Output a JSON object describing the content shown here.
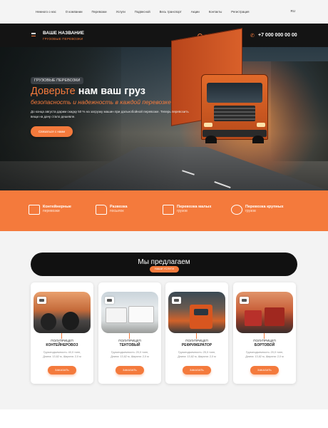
{
  "topnav": {
    "items": [
      "Немного о нас",
      "О компании",
      "Перевозки",
      "Услуги",
      "Подвесной",
      "Весь транспорт",
      "Акции",
      "Контакты",
      "Регистрация"
    ],
    "lang": "RU"
  },
  "header": {
    "title": "ВАШЕ НАЗВАНИЕ",
    "subtitle": "ГРУЗОВЫЕ ПЕРЕВОЗКИ",
    "hours": "Ежедневно: 09:00—21:00",
    "phone": "+7 000 000 00 00"
  },
  "hero": {
    "badge": "ГРУЗОВЫЕ ПЕРЕВОЗКИ",
    "title_prefix": "Доверьте",
    "title_bold": "нам ваш груз",
    "subtitle": "безопасность и надежность в каждой перевозке",
    "description": "До конца августа дарим скидку 50 % на загрузку машин при дальнобойной перевозке. Теперь перевозить вещи на дачу стало дешевле.",
    "button": "Связаться с нами"
  },
  "services": [
    {
      "title": "Контейнерные",
      "sub": "перевозки",
      "icon": "container-icon"
    },
    {
      "title": "Развозка",
      "sub": "посылок",
      "icon": "delivery-truck-icon"
    },
    {
      "title": "Перевозка малых",
      "sub": "грузов",
      "icon": "boxes-icon"
    },
    {
      "title": "Перевозка крупных",
      "sub": "грузов",
      "icon": "globe-icon"
    }
  ],
  "offer": {
    "title": "Мы предлагаем",
    "tag": "НАШИ УСЛУГИ"
  },
  "cards": [
    {
      "line1": "ПОЛУПРИЦЕП",
      "line2": "КОНТЕЙНЕРОВОЗ",
      "spec1": "Грузоподъемность: 40,0 тонн,",
      "spec2": "Длина: 13,62 м, Ширина: 2,0 м",
      "order": "ЗАКАЗАТЬ",
      "icon": "container-icon"
    },
    {
      "line1": "ПОЛУПРИЦЕП",
      "line2": "ТЕНТОВЫЙ",
      "spec1": "Грузоподъемность: 20,0 тонн,",
      "spec2": "Длина: 13,62 м, Ширина: 2,0 м",
      "order": "ЗАКАЗАТЬ",
      "icon": "truck-icon"
    },
    {
      "line1": "ПОЛУПРИЦЕП",
      "line2": "РЕФРИЖЕРАТОР",
      "spec1": "Грузоподъемность: 25,0 тонн,",
      "spec2": "Длина: 13,62 м, Ширина: 2,0 м",
      "order": "ЗАКАЗАТЬ",
      "icon": "fridge-truck-icon"
    },
    {
      "line1": "ПОЛУПРИЦЕП",
      "line2": "БОРТОВОЙ",
      "spec1": "Грузоподъемность: 20,0 тонн,",
      "spec2": "Длина: 13,62 м, Ширина: 2,0 м",
      "order": "ЗАКАЗАТЬ",
      "icon": "flatbed-icon"
    }
  ],
  "colors": {
    "accent": "#f47a3c",
    "dark": "#141414",
    "band": "#f47a3c"
  }
}
